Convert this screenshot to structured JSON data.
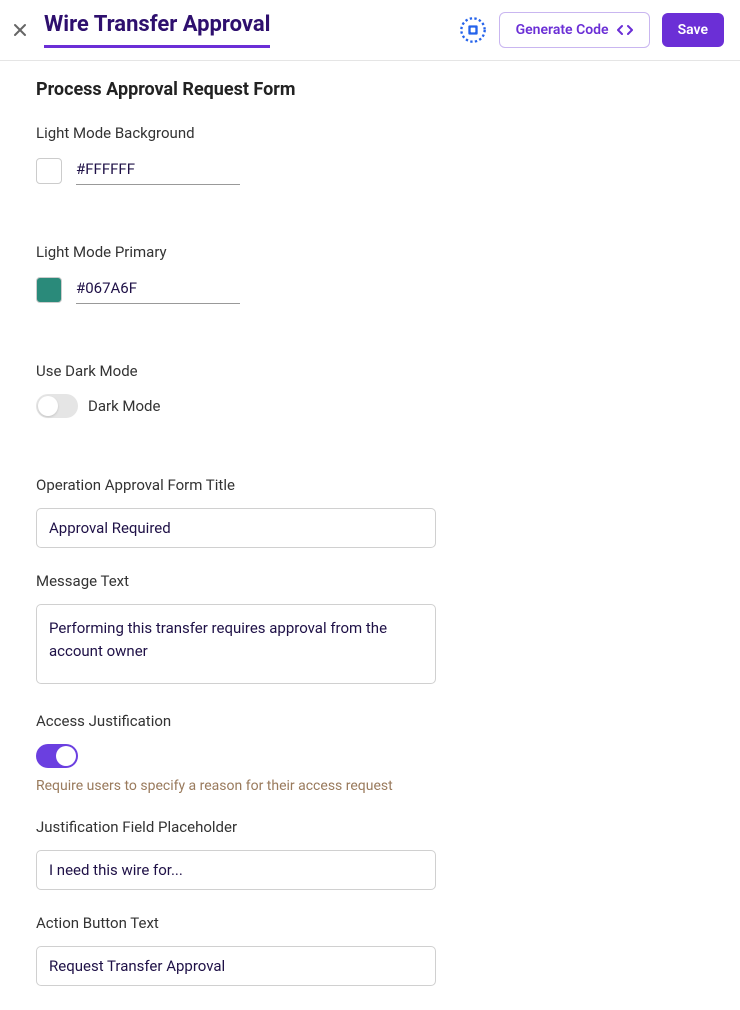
{
  "header": {
    "title": "Wire Transfer Approval",
    "generate_code_label": "Generate Code",
    "save_label": "Save"
  },
  "form": {
    "section_title": "Process Approval Request Form",
    "light_bg": {
      "label": "Light Mode Background",
      "value": "#FFFFFF",
      "swatch": "#FFFFFF"
    },
    "light_primary": {
      "label": "Light Mode Primary",
      "value": "#067A6F",
      "swatch": "#2a8a7a"
    },
    "dark_mode": {
      "label": "Use Dark Mode",
      "toggle_label": "Dark Mode",
      "enabled": false
    },
    "form_title": {
      "label": "Operation Approval Form Title",
      "value": "Approval Required"
    },
    "message_text": {
      "label": "Message Text",
      "value": "Performing this transfer requires approval from the account owner"
    },
    "access_justification": {
      "label": "Access Justification",
      "enabled": true,
      "helper": "Require users to specify a reason for their access request"
    },
    "justification_placeholder": {
      "label": "Justification Field Placeholder",
      "value": "I need this wire for..."
    },
    "action_button": {
      "label": "Action Button Text",
      "value": "Request Transfer Approval"
    }
  }
}
